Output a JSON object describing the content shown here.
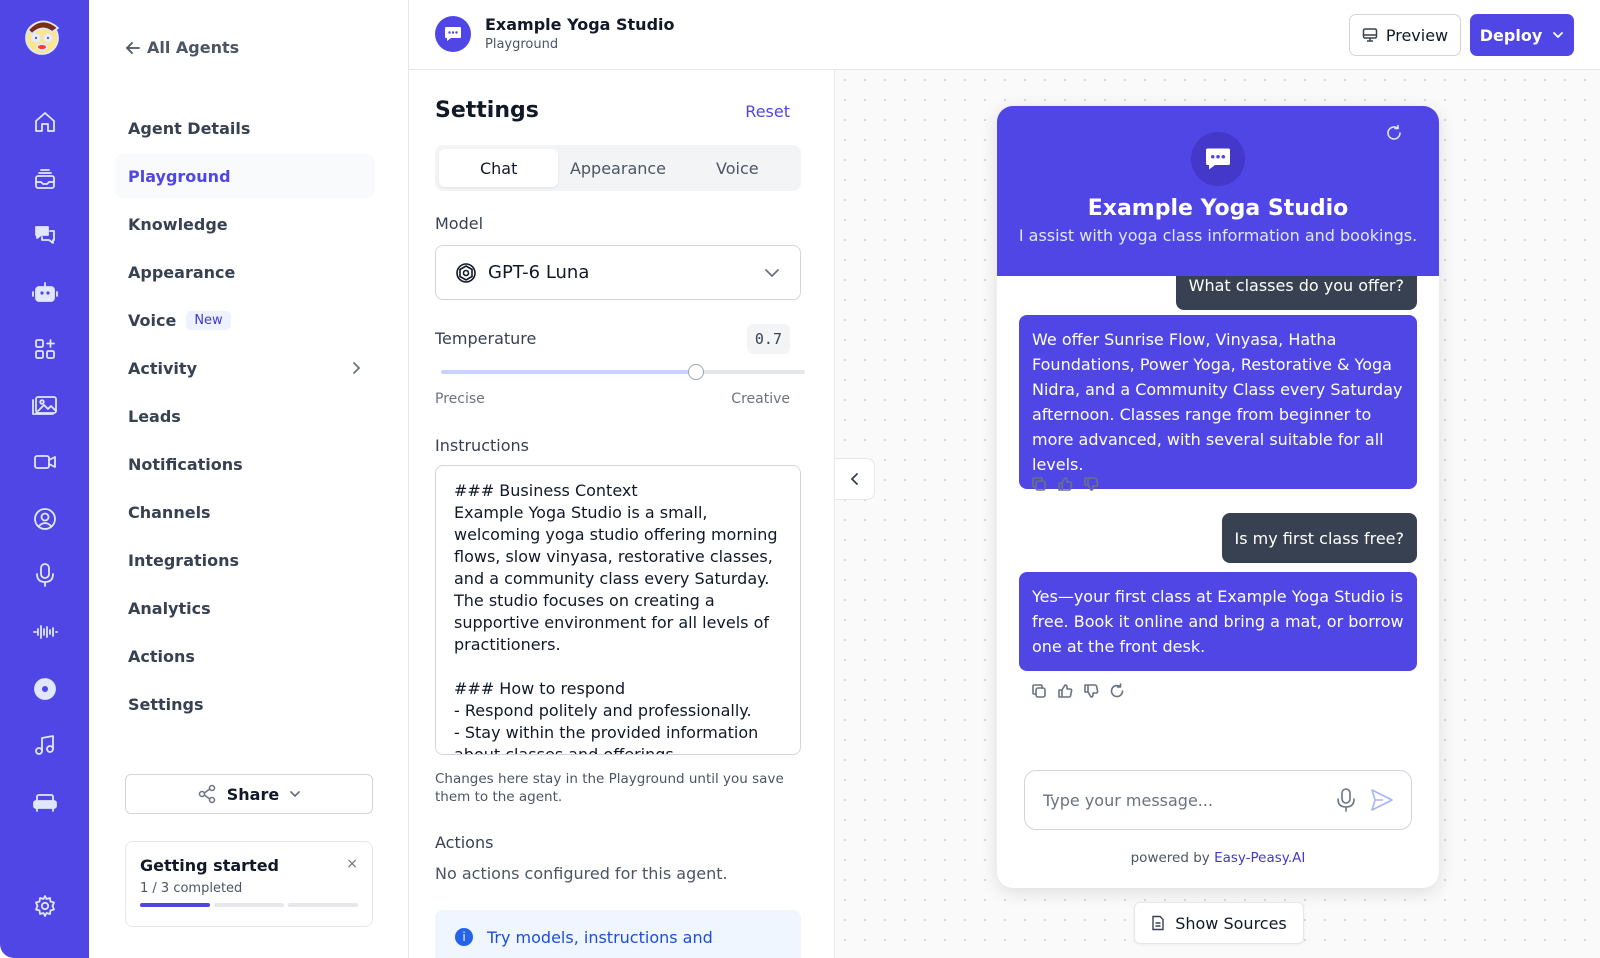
{
  "nav": {
    "back_label": "All Agents",
    "items": [
      {
        "label": "Agent Details"
      },
      {
        "label": "Playground"
      },
      {
        "label": "Knowledge"
      },
      {
        "label": "Appearance"
      },
      {
        "label": "Voice",
        "badge": "New"
      },
      {
        "label": "Activity"
      },
      {
        "label": "Leads"
      },
      {
        "label": "Notifications"
      },
      {
        "label": "Channels"
      },
      {
        "label": "Integrations"
      },
      {
        "label": "Analytics"
      },
      {
        "label": "Actions"
      },
      {
        "label": "Settings"
      }
    ],
    "share_label": "Share",
    "getting_started": {
      "title": "Getting started",
      "progress_text": "1 / 3 completed",
      "close": "×",
      "completed": 1,
      "total": 3
    }
  },
  "header": {
    "title": "Example Yoga Studio",
    "subtitle": "Playground",
    "preview_label": "Preview",
    "deploy_label": "Deploy"
  },
  "settings": {
    "title": "Settings",
    "reset_label": "Reset",
    "tabs": [
      {
        "label": "Chat"
      },
      {
        "label": "Appearance"
      },
      {
        "label": "Voice"
      }
    ],
    "model_label": "Model",
    "model_value": "GPT-6 Luna",
    "temperature_label": "Temperature",
    "temperature_value": "0.7",
    "temperature_level": 0.7,
    "precise_label": "Precise",
    "creative_label": "Creative",
    "instructions_label": "Instructions",
    "instructions_text": "### Business Context\nExample Yoga Studio is a small, welcoming yoga studio offering morning flows, slow vinyasa, restorative classes, and a community class every Saturday. The studio focuses on creating a supportive environment for all levels of practitioners.\n\n### How to respond\n- Respond politely and professionally.\n- Stay within the provided information about classes and offerings.\n- Avoid inventing class details, prices, or",
    "instructions_note": "Changes here stay in the Playground until you save them to the agent.",
    "actions_label": "Actions",
    "actions_empty": "No actions configured for this agent.",
    "tip_text": "Try models, instructions and"
  },
  "chat": {
    "name": "Example Yoga Studio",
    "description": "I assist with yoga class information and bookings.",
    "messages": [
      {
        "role": "user",
        "text": "What classes do you offer?"
      },
      {
        "role": "bot",
        "text": "We offer Sunrise Flow, Vinyasa, Hatha Foundations, Power Yoga, Restorative & Yoga Nidra, and a Community Class every Saturday afternoon. Classes range from beginner to more advanced, with several suitable for all levels."
      },
      {
        "role": "user",
        "text": "Is my first class free?"
      },
      {
        "role": "bot",
        "text": "Yes—your first class at Example Yoga Studio is free. Book it online and bring a mat, or borrow one at the front desk."
      }
    ],
    "input_placeholder": "Type your message...",
    "powered_prefix": "powered by",
    "powered_brand": "Easy-Peasy.AI",
    "sources_label": "Show Sources"
  },
  "colors": {
    "accent": "#4f46e5",
    "user_bubble": "#374151",
    "rail": "#4f46e5"
  },
  "icons": [
    "home-icon",
    "inbox-icon",
    "chat-icon",
    "robot-icon",
    "apps-icon",
    "gallery-icon",
    "video-icon",
    "user-circle-icon",
    "microphone-icon",
    "waveform-icon",
    "record-icon",
    "music-icon",
    "sofa-icon",
    "gear-icon"
  ]
}
